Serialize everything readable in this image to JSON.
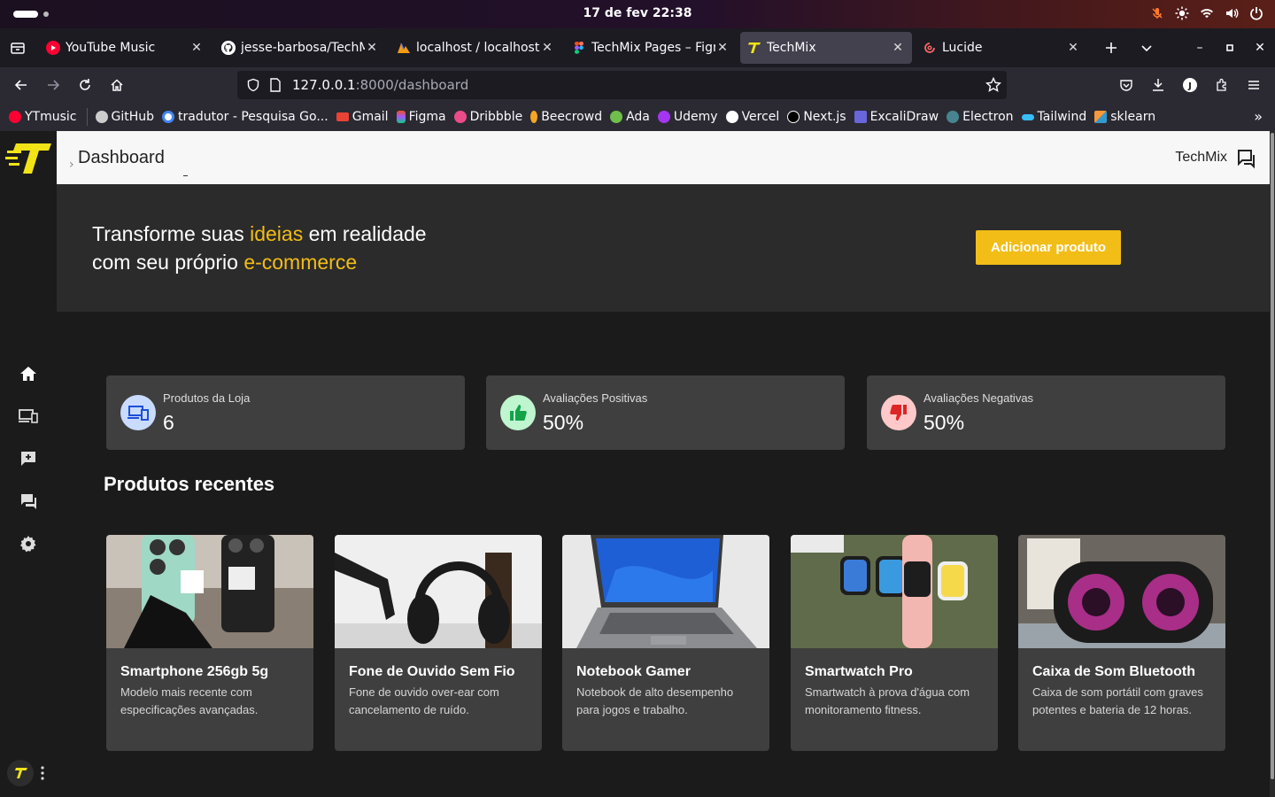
{
  "os": {
    "clock": "17 de fev  22:38"
  },
  "tabs": [
    {
      "title": "YouTube Music",
      "icon": "youtube-music-icon",
      "active": false
    },
    {
      "title": "jesse-barbosa/TechM",
      "icon": "github-icon",
      "active": false
    },
    {
      "title": "localhost / localhost /",
      "icon": "phpmyadmin-icon",
      "active": false
    },
    {
      "title": "TechMix Pages – Figm",
      "icon": "figma-icon",
      "active": false
    },
    {
      "title": "TechMix",
      "icon": "techmix-icon",
      "active": true
    },
    {
      "title": "Lucide",
      "icon": "lucide-icon",
      "active": false
    }
  ],
  "navbar": {
    "url_host": "127.0.0.1",
    "url_path": ":8000/dashboard"
  },
  "bookmarks": [
    {
      "label": "YTmusic",
      "icon": "youtube-music-icon",
      "color": "#ff0033"
    },
    {
      "label": "GitHub",
      "icon": "github-icon",
      "color": "#cccccc"
    },
    {
      "label": "tradutor - Pesquisa Go...",
      "icon": "google-icon",
      "color": "#ffffff"
    },
    {
      "label": "Gmail",
      "icon": "gmail-icon",
      "color": "#ea4335"
    },
    {
      "label": "Figma",
      "icon": "figma-icon",
      "color": "#a259ff"
    },
    {
      "label": "Dribbble",
      "icon": "dribbble-icon",
      "color": "#ea4c89"
    },
    {
      "label": "Beecrowd",
      "icon": "beecrowd-icon",
      "color": "#f5a623"
    },
    {
      "label": "Ada",
      "icon": "ada-icon",
      "color": "#6fbf4a"
    },
    {
      "label": "Udemy",
      "icon": "udemy-icon",
      "color": "#a435f0"
    },
    {
      "label": "Vercel",
      "icon": "vercel-icon",
      "color": "#ffffff"
    },
    {
      "label": "Next.js",
      "icon": "nextjs-icon",
      "color": "#ffffff"
    },
    {
      "label": "ExcaliDraw",
      "icon": "excalidraw-icon",
      "color": "#6965db"
    },
    {
      "label": "Electron",
      "icon": "electron-icon",
      "color": "#47848f"
    },
    {
      "label": "Tailwind",
      "icon": "tailwind-icon",
      "color": "#38bdf8"
    },
    {
      "label": "sklearn",
      "icon": "sklearn-icon",
      "color": "#f89939"
    }
  ],
  "header": {
    "title": "Dashboard",
    "brand": "TechMix"
  },
  "hero": {
    "line1_pre": "Transforme suas ",
    "line1_accent": "ideias",
    "line1_post": " em realidade",
    "line2_pre": "com seu próprio ",
    "line2_accent": "e-commerce",
    "button": "Adicionar produto"
  },
  "stats": [
    {
      "label": "Produtos da Loja",
      "value": "6",
      "icon": "devices-icon"
    },
    {
      "label": "Avaliações Positivas",
      "value": "50%",
      "icon": "thumbs-up-icon"
    },
    {
      "label": "Avaliações Negativas",
      "value": "50%",
      "icon": "thumbs-down-icon"
    }
  ],
  "recent_title": "Produtos recentes",
  "products": [
    {
      "name": "Smartphone 256gb 5g",
      "desc": "Modelo mais recente com especificações avançadas."
    },
    {
      "name": "Fone de Ouvido Sem Fio",
      "desc": "Fone de ouvido over-ear com cancelamento de ruído."
    },
    {
      "name": "Notebook Gamer",
      "desc": "Notebook de alto desempenho para jogos e trabalho."
    },
    {
      "name": "Smartwatch Pro",
      "desc": "Smartwatch à prova d'água com monitoramento fitness."
    },
    {
      "name": "Caixa de Som Bluetooth",
      "desc": "Caixa de som portátil com graves potentes e bateria de 12 horas."
    }
  ],
  "colors": {
    "accent": "#f2bd17",
    "card_bg": "#3f3f3f",
    "page_bg": "#1b1b1b"
  }
}
